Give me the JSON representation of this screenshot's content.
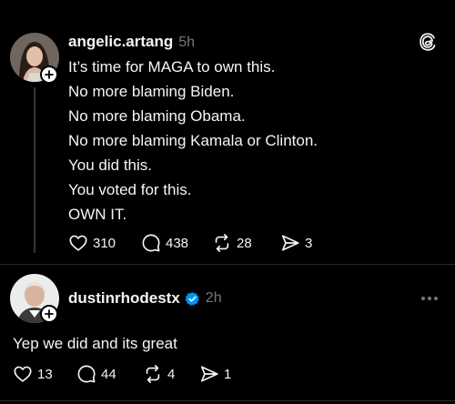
{
  "post": {
    "username": "angelic.artang",
    "time": "5h",
    "lines": [
      "It’s time for MAGA to own this.",
      "No more blaming Biden.",
      "No more blaming Obama.",
      "No more blaming Kamala or Clinton.",
      "You did this.",
      "You voted for this.",
      "OWN IT."
    ],
    "likes": "310",
    "replies": "438",
    "reposts": "28",
    "shares": "3"
  },
  "reply": {
    "username": "dustinrhodestx",
    "time": "2h",
    "text": "Yep we did and its great",
    "likes": "13",
    "replies": "44",
    "reposts": "4",
    "shares": "1",
    "verified_color": "#0095f6"
  },
  "icons": {
    "app": "threads-logo-icon",
    "more": "more-options-icon",
    "like": "heart-icon",
    "reply": "comment-icon",
    "repost": "repost-icon",
    "share": "share-icon",
    "follow": "plus-icon",
    "verified": "verified-badge-icon"
  }
}
